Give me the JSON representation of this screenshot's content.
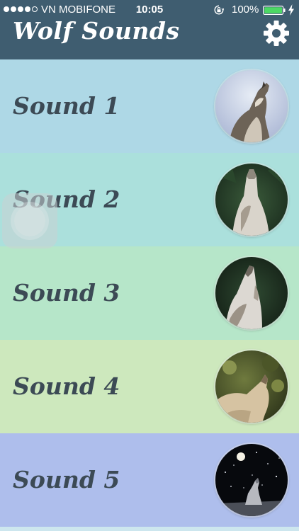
{
  "status_bar": {
    "signal_dots_filled": 4,
    "signal_dots_total": 5,
    "carrier": "VN MOBIFONE",
    "time": "10:05",
    "rotation_lock_icon": "rotation-lock-icon",
    "battery_percent": "100%",
    "battery_icon": "battery-icon",
    "charging_icon": "charging-bolt-icon"
  },
  "header": {
    "title": "Wolf Sounds",
    "settings_icon": "gear-icon",
    "background": "#3f5d70"
  },
  "sounds": [
    {
      "label": "Sound 1",
      "image": "wolf-howling-photo",
      "background": "#aed8e6"
    },
    {
      "label": "Sound 2",
      "image": "wolf-howling-photo",
      "background": "#abe0dc"
    },
    {
      "label": "Sound 3",
      "image": "wolf-howling-photo",
      "background": "#b6e6c9"
    },
    {
      "label": "Sound 4",
      "image": "wolf-howling-photo",
      "background": "#cde8bd"
    },
    {
      "label": "Sound 5",
      "image": "wolf-howling-moon-photo",
      "background": "#aebeec"
    }
  ],
  "overlay": {
    "assistive_touch_icon": "assistive-touch-icon"
  }
}
